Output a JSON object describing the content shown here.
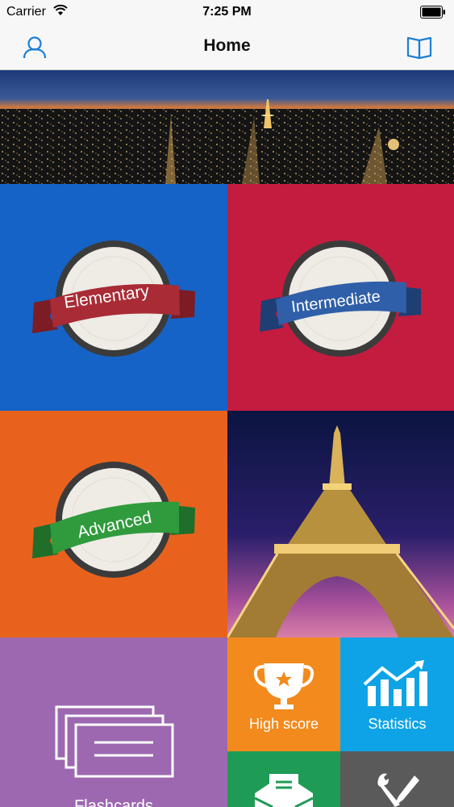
{
  "status_bar": {
    "carrier": "Carrier",
    "time": "7:25 PM"
  },
  "nav": {
    "title": "Home",
    "left_icon": "person-icon",
    "right_icon": "book-icon",
    "accent": "#1b7fd4"
  },
  "tiles": {
    "elementary": {
      "label": "Elementary",
      "color": "#1563c6",
      "ribbon": "#a92b35"
    },
    "intermediate": {
      "label": "Intermediate",
      "color": "#c31c3f",
      "ribbon": "#2f5fa8"
    },
    "advanced": {
      "label": "Advanced",
      "color": "#e8621e",
      "ribbon": "#2f9b3c"
    },
    "flashcards": {
      "label": "Flashcards",
      "color": "#9d68b0",
      "icon": "cards-icon"
    },
    "high_score": {
      "label": "High score",
      "color": "#f28a1d",
      "icon": "trophy-icon"
    },
    "statistics": {
      "label": "Statistics",
      "color": "#0ea3e6",
      "icon": "chart-icon"
    },
    "mail": {
      "color": "#1e9b55",
      "icon": "mail-icon"
    },
    "settings": {
      "color": "#5a5a5a",
      "icon": "wrench-icon"
    }
  }
}
